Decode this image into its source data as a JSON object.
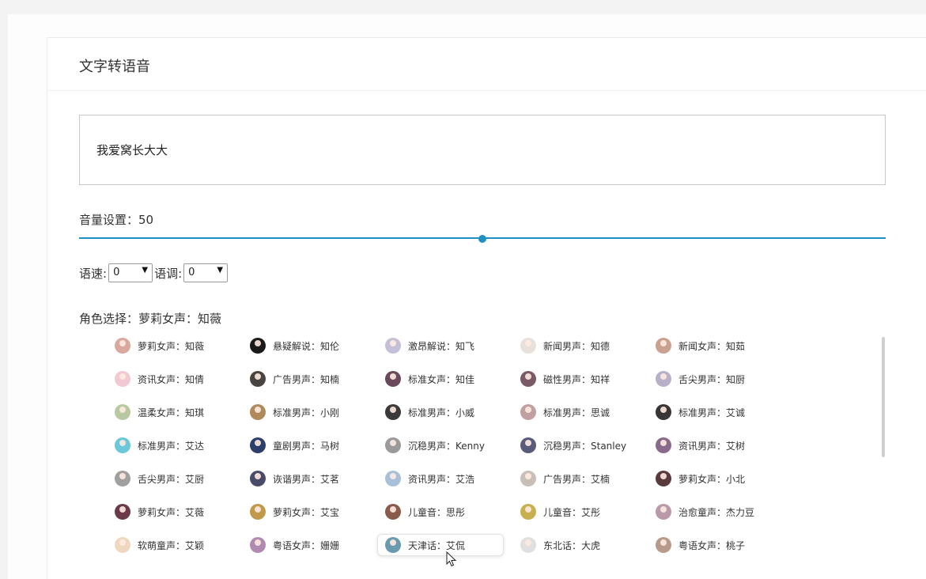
{
  "card": {
    "title": "文字转语音"
  },
  "text_input": {
    "value": "我爱窝长大大"
  },
  "volume": {
    "label": "音量设置：50",
    "value": 50,
    "max": 100
  },
  "speed": {
    "label": "语速:",
    "value": "0"
  },
  "pitch": {
    "label": "语调:",
    "value": "0"
  },
  "role": {
    "label": "角色选择：萝莉女声：知薇"
  },
  "voices": [
    {
      "name": "萝莉女声：知薇",
      "color": "#d9a9a0"
    },
    {
      "name": "悬疑解说：知伦",
      "color": "#1a1a1a"
    },
    {
      "name": "激昂解说：知飞",
      "color": "#c4c0d8"
    },
    {
      "name": "新闻男声：知德",
      "color": "#e8e0dc"
    },
    {
      "name": "新闻女声：知茹",
      "color": "#caa08e"
    },
    {
      "name": "资讯女声：知倩",
      "color": "#f2c8d2"
    },
    {
      "name": "广告男声：知楠",
      "color": "#4a4440"
    },
    {
      "name": "标准女声：知佳",
      "color": "#6a4a5a"
    },
    {
      "name": "磁性男声：知祥",
      "color": "#7a5a66"
    },
    {
      "name": "舌尖男声：知厨",
      "color": "#b8b0c8"
    },
    {
      "name": "温柔女声：知琪",
      "color": "#b8c8a0"
    },
    {
      "name": "标准男声：小刚",
      "color": "#b08a5a"
    },
    {
      "name": "标准男声：小威",
      "color": "#3a3a3a"
    },
    {
      "name": "标准男声：思诚",
      "color": "#c0a0a0"
    },
    {
      "name": "标准男声：艾诚",
      "color": "#3a3535"
    },
    {
      "name": "标准男声：艾达",
      "color": "#6ac8d8"
    },
    {
      "name": "童剧男声：马树",
      "color": "#2c3e6a"
    },
    {
      "name": "沉稳男声：Kenny",
      "color": "#9a9a9a"
    },
    {
      "name": "沉稳男声：Stanley",
      "color": "#5a5a7a"
    },
    {
      "name": "资讯男声：艾树",
      "color": "#8a6a8a"
    },
    {
      "name": "舌尖男声：艾厨",
      "color": "#a0a0a0"
    },
    {
      "name": "诙谐男声：艾茗",
      "color": "#4a4a6a"
    },
    {
      "name": "资讯男声：艾浩",
      "color": "#a8c0d8"
    },
    {
      "name": "广告男声：艾楠",
      "color": "#c8c0b8"
    },
    {
      "name": "萝莉女声：小北",
      "color": "#5a3a3a"
    },
    {
      "name": "萝莉女声：艾薇",
      "color": "#6a3a4a"
    },
    {
      "name": "萝莉女声：艾宝",
      "color": "#c09a4a"
    },
    {
      "name": "儿童音：思彤",
      "color": "#8a5a4a"
    },
    {
      "name": "儿童音：艾彤",
      "color": "#c8b050"
    },
    {
      "name": "治愈童声：杰力豆",
      "color": "#b89aa8"
    },
    {
      "name": "软萌童声：艾颖",
      "color": "#f0d8c0"
    },
    {
      "name": "粤语女声：姗姗",
      "color": "#b08ab0"
    },
    {
      "name": "天津话：艾侃",
      "color": "#6a9ab0"
    },
    {
      "name": "东北话：大虎",
      "color": "#e0e0e0"
    },
    {
      "name": "粤语女声：桃子",
      "color": "#b89a8a"
    }
  ]
}
